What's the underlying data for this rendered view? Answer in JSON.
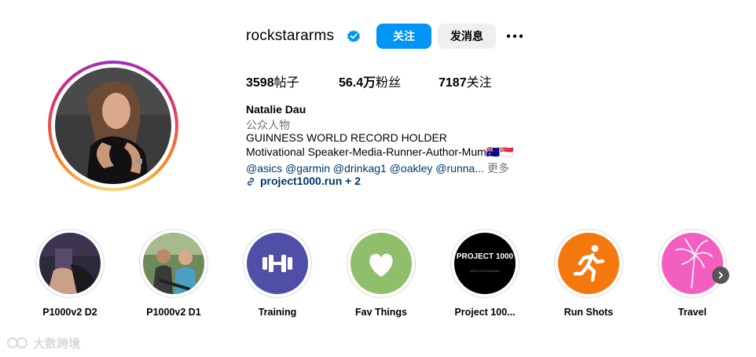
{
  "profile": {
    "username": "rockstararms",
    "follow_label": "关注",
    "message_label": "发消息",
    "more_label": "•••"
  },
  "stats": [
    {
      "value": "3598",
      "label": "帖子"
    },
    {
      "value": "56.4万",
      "label": "粉丝"
    },
    {
      "value": "7187",
      "label": "关注"
    }
  ],
  "bio": {
    "name": "Natalie Dau",
    "category": "公众人物",
    "line1": "GUINNESS WORLD RECORD HOLDER",
    "line2": "Motivational Speaker-Media-Runner-Author-Mum🇦🇺🇸🇬",
    "mentions": [
      "@asics",
      "@garmin",
      "@drinkag1",
      "@oakley",
      "@runna..."
    ],
    "more_label": "更多",
    "link": "project1000.run + 2"
  },
  "highlights": [
    {
      "label": "P1000v2 D2"
    },
    {
      "label": "P1000v2 D1"
    },
    {
      "label": "Training"
    },
    {
      "label": "Fav Things"
    },
    {
      "label": "Project 100...",
      "cover_text": "PROJECT 1000",
      "cover_subtext": "@ROCKSTARARMS"
    },
    {
      "label": "Run Shots"
    },
    {
      "label": "Travel"
    }
  ],
  "colors": {
    "accent": "#0095f6",
    "link": "#00376b",
    "training_bg": "#4f4fa8",
    "fav_bg": "#8fbf6a",
    "run_bg": "#f5780f",
    "travel_bg": "#f25fbf"
  },
  "icons": [
    "verified-badge-icon",
    "more-options-icon",
    "link-icon",
    "dumbbell-icon",
    "heart-icon",
    "runner-icon",
    "palm-tree-icon",
    "chevron-right-icon"
  ],
  "watermark": "大数跨境"
}
